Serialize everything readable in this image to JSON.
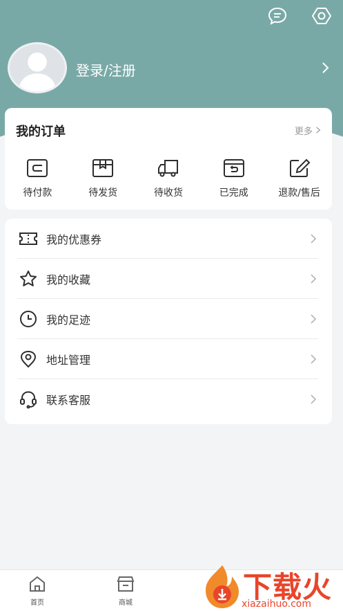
{
  "header": {
    "login_label": "登录/注册",
    "icons": [
      "message-icon",
      "settings-icon"
    ],
    "background_color": "#79a9a6"
  },
  "orders": {
    "title": "我的订单",
    "more_label": "更多",
    "items": [
      {
        "label": "待付款",
        "icon": "wallet-icon"
      },
      {
        "label": "待发货",
        "icon": "box-icon"
      },
      {
        "label": "待收货",
        "icon": "truck-icon"
      },
      {
        "label": "已完成",
        "icon": "done-box-icon"
      },
      {
        "label": "退款/售后",
        "icon": "edit-icon"
      }
    ]
  },
  "menu": {
    "items": [
      {
        "label": "我的优惠券",
        "icon": "coupon-icon"
      },
      {
        "label": "我的收藏",
        "icon": "star-icon"
      },
      {
        "label": "我的足迹",
        "icon": "clock-icon"
      },
      {
        "label": "地址管理",
        "icon": "location-icon"
      },
      {
        "label": "联系客服",
        "icon": "headset-icon"
      }
    ]
  },
  "tabbar": {
    "items": [
      {
        "label": "首页",
        "icon": "home-icon"
      },
      {
        "label": "商城",
        "icon": "store-icon"
      }
    ]
  },
  "watermark": {
    "text": "下载火",
    "url": "xiazaihuo.com"
  }
}
